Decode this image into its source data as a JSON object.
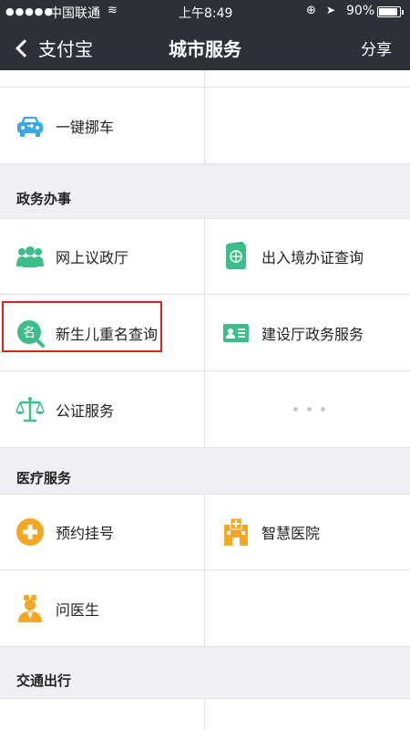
{
  "status_bar": {
    "signal": "●●●●●",
    "carrier": "中国联通",
    "wifi": "≋",
    "time": "上午8:49",
    "rotation_lock": "⊕",
    "location": "➤",
    "battery_percent": "90%",
    "battery_level": 0.9
  },
  "nav": {
    "back_label": "支付宝",
    "title": "城市服务",
    "share_label": "分享"
  },
  "rows_top": {
    "move_car": "一键挪车"
  },
  "sections": {
    "government": "政务办事",
    "medical": "医疗服务",
    "transport": "交通出行"
  },
  "government_items": {
    "online_hall": "网上议政厅",
    "entry_exit": "出入境办证查询",
    "newborn_name": "新生儿重名查询",
    "construction": "建设厅政务服务",
    "notary": "公证服务"
  },
  "medical_items": {
    "appointment": "预约挂号",
    "smart_hospital": "智慧医院",
    "ask_doctor": "问医生"
  },
  "colors": {
    "nav_bg": "#2d3137",
    "green": "#3dbd8a",
    "orange": "#f5a623",
    "blue": "#3aa8e8",
    "highlight_border": "#e0201f"
  }
}
